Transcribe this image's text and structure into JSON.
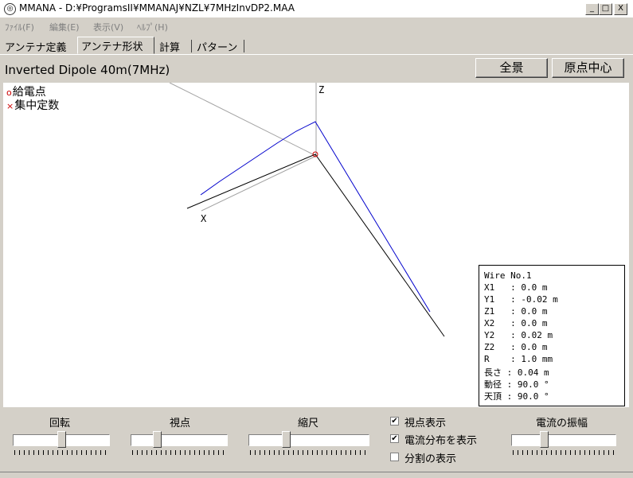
{
  "window": {
    "icon": "mmana-app-icon",
    "title": "MMANA - D:¥ProgramsII¥MMANAJ¥NZL¥7MHzInvDP2.MAA",
    "minimize": "_",
    "maximize": "□",
    "close": "X"
  },
  "menu": [
    "ﾌｧｲﾙ(F)",
    "編集(E)",
    "表示(V)",
    "ﾍﾙﾌﾟ(H)"
  ],
  "tabs": [
    "アンテナ定義",
    "アンテナ形状",
    "計算",
    "パターン"
  ],
  "active_tab": "アンテナ形状",
  "view": {
    "antenna_name": "Inverted Dipole 40m(7MHz)",
    "btn_full_view": "全景",
    "btn_origin_center": "原点中心"
  },
  "legend": {
    "feed_marker": "o",
    "feed_label": "給電点",
    "load_marker": "×",
    "load_label": "集中定数"
  },
  "chart_data": {
    "axis_labels": {
      "z": "Z",
      "x": "X"
    },
    "wire_color": "#000000",
    "current_color": "#0000cc",
    "feed_color": "#cc0000"
  },
  "wire_info": [
    "Wire No.1",
    "X1   : 0.0 m",
    "Y1   : -0.02 m",
    "Z1   : 0.0 m",
    "X2   : 0.0 m",
    "Y2   : 0.02 m",
    "Z2   : 0.0 m",
    "R    : 1.0 mm",
    "長さ : 0.04 m",
    "動径 : 90.0 °",
    "天頂 : 90.0 °"
  ],
  "controls": {
    "rotation_label": "回転",
    "viewpoint_label": "視点",
    "scale_label": "縮尺",
    "amplitude_label": "電流の振幅",
    "sliders": {
      "rotation": 0.5,
      "viewpoint": 0.25,
      "scale": 0.3,
      "amplitude": 0.3
    },
    "checkboxes": [
      {
        "label": "視点表示",
        "checked": true
      },
      {
        "label": "電流分布を表示",
        "checked": true
      },
      {
        "label": "分割の表示",
        "checked": false
      }
    ],
    "check_mark": "✔"
  }
}
